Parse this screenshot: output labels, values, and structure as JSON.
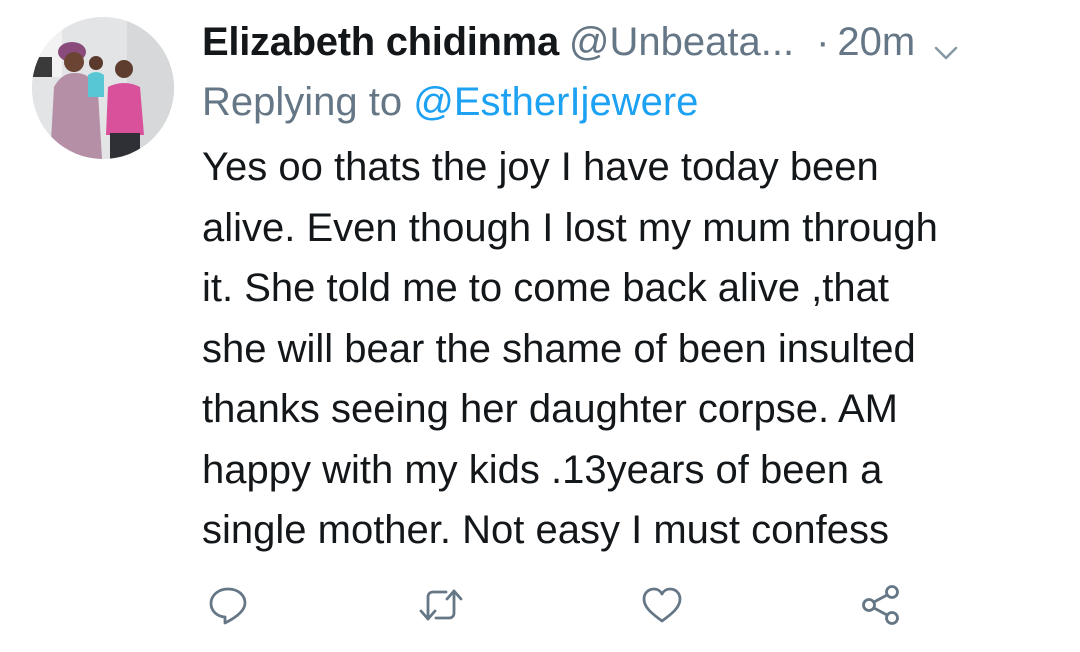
{
  "tweet": {
    "display_name": "Elizabeth chidinma",
    "handle": "@Unbeata...",
    "separator": "·",
    "time": "20m",
    "replying_prefix": "Replying to ",
    "replying_to": "@EstherIjewere",
    "text_lines": [
      "Yes oo thats the joy I have today been",
      "alive. Even though I lost my mum through",
      "it. She told me to come back alive ,that",
      "she will bear the shame of been insulted",
      "thanks seeing her daughter corpse. AM",
      "happy with my kids .13years of been a",
      "single mother. Not easy I must confess"
    ]
  },
  "icons": {
    "menu": "chevron-down-icon",
    "reply": "reply-icon",
    "retweet": "retweet-icon",
    "like": "heart-icon",
    "share": "share-icon"
  },
  "colors": {
    "text": "#14171a",
    "secondary": "#657786",
    "link": "#1da1f2",
    "icon": "#657786"
  }
}
